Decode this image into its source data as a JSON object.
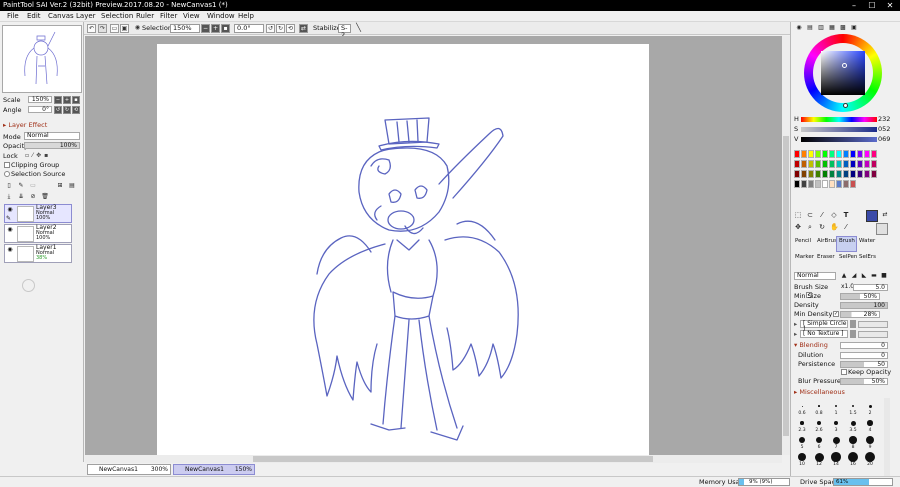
{
  "window": {
    "title": "PaintTool SAI Ver.2 (32bit) Preview.2017.08.20 - NewCanvas1 (*)",
    "minimize": "–",
    "maximize": "☐",
    "close": "✕"
  },
  "menu": [
    "File",
    "Edit",
    "Canvas",
    "Layer",
    "Selection",
    "Ruler",
    "Filter",
    "View",
    "Window",
    "Help"
  ],
  "toolbar": {
    "selection_label": "Selection",
    "zoom": "150%",
    "angle": "0.0°",
    "stabilizer_label": "Stabilizer",
    "stabilizer": "S-2"
  },
  "navigator": {
    "scale_label": "Scale",
    "scale": "150%",
    "angle_label": "Angle",
    "angle": "0°"
  },
  "layer_panel": {
    "effect_label": "Layer Effect",
    "mode_label": "Mode",
    "mode": "Normal",
    "opacity_label": "Opacity",
    "opacity": "100%",
    "lock_label": "Lock",
    "clipping": "Clipping Group",
    "selection_source": "Selection Source",
    "layers": [
      {
        "name": "Layer3",
        "mode": "Normal",
        "opacity": "100%",
        "selected": true
      },
      {
        "name": "Layer2",
        "mode": "Normal",
        "opacity": "100%",
        "selected": false
      },
      {
        "name": "Layer1",
        "mode": "Normal",
        "opacity": "38%",
        "selected": false
      }
    ]
  },
  "tabs": [
    {
      "name": "NewCanvas1",
      "zoom": "300%"
    },
    {
      "name": "NewCanvas1",
      "zoom": "150%"
    }
  ],
  "status": {
    "memory_label": "Memory Usage",
    "memory": "9% (9%)",
    "memory_fraction": 0.09,
    "drive_label": "Drive Space",
    "drive": "61%",
    "drive_fraction": 0.61
  },
  "color": {
    "current": "#3a4aa8",
    "h_label": "H",
    "h": "232",
    "s_label": "S",
    "s": "052",
    "v_label": "V",
    "v": "069"
  },
  "palette": [
    "#ff0000",
    "#ff8000",
    "#ffff00",
    "#80ff00",
    "#00ff00",
    "#00ff80",
    "#00ffff",
    "#0080ff",
    "#0000ff",
    "#8000ff",
    "#ff00ff",
    "#ff0080",
    "#c00000",
    "#c06000",
    "#c0c000",
    "#60c000",
    "#00c000",
    "#00c060",
    "#00c0c0",
    "#0060c0",
    "#0000c0",
    "#6000c0",
    "#c000c0",
    "#c00060",
    "#800000",
    "#804000",
    "#808000",
    "#408000",
    "#008000",
    "#008040",
    "#008080",
    "#004080",
    "#000080",
    "#400080",
    "#800080",
    "#800040",
    "#000000",
    "#404040",
    "#808080",
    "#c0c0c0",
    "#ffffff",
    "#ffe0c0",
    "#5c7cc8",
    "#8c6c6c",
    "#c85050"
  ],
  "tools": [
    "Pencil",
    "AirBrush",
    "Brush",
    "Water",
    "Marker",
    "Eraser",
    "SelPen",
    "SelErs"
  ],
  "brush": {
    "mode": "Normal",
    "size_label": "Brush Size",
    "size_mult": "x1.0",
    "size": "5.0",
    "min_size_label": "Min Size",
    "min_size": "50%",
    "density_label": "Density",
    "density": "100",
    "min_density_label": "Min Density",
    "min_density": "28%",
    "shape": "[ Simple Circle ]",
    "texture": "[ No Texture ]",
    "blending_label": "Blending",
    "blending": "0",
    "dilution_label": "Dilution",
    "dilution": "0",
    "persistence_label": "Persistence",
    "persistence": "50",
    "keep_opacity": "Keep Opacity",
    "blur_label": "Blur Pressure",
    "blur": "50%",
    "misc_label": "Miscellaneous"
  },
  "brush_sizes": [
    "0.6",
    "0.8",
    "1",
    "1.5",
    "2",
    "2.3",
    "2.6",
    "3",
    "3.5",
    "4",
    "5",
    "6",
    "7",
    "8",
    "9",
    "10",
    "12",
    "14",
    "16",
    "20"
  ]
}
